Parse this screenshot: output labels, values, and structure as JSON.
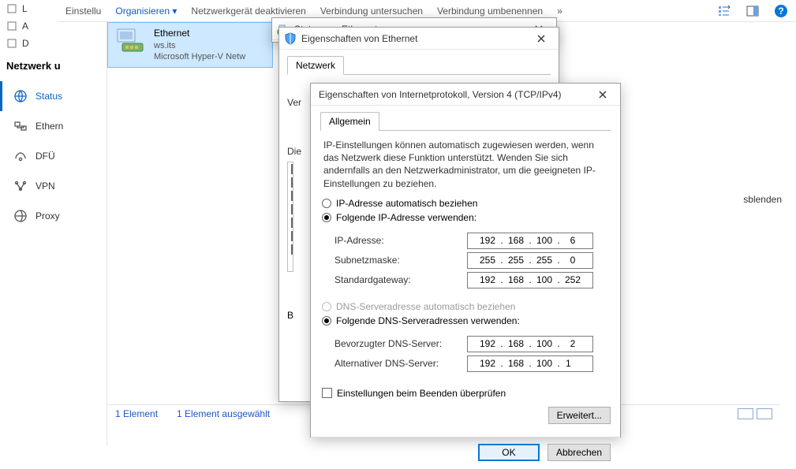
{
  "sidebar": {
    "stubs": [
      "L",
      "A",
      "D"
    ],
    "heading": "Netzwerk u",
    "items": [
      {
        "label": "Status"
      },
      {
        "label": "Ethern"
      },
      {
        "label": "DFÜ"
      },
      {
        "label": "VPN"
      },
      {
        "label": "Proxy"
      }
    ]
  },
  "toolbar": {
    "settings": "Einstellu",
    "organize": "Organisieren ▾",
    "disable": "Netzwerkgerät deaktivieren",
    "diagnose": "Verbindung untersuchen",
    "rename": "Verbindung umbenennen",
    "overflow": "»"
  },
  "connection": {
    "name": "Ethernet",
    "domain": "ws.its",
    "adapter": "Microsoft Hyper-V Netw"
  },
  "win_status_title": "Status von Ethernet",
  "win_eth": {
    "title": "Eigenschaften von Ethernet",
    "tab": "Netzwerk",
    "line1": "Ver",
    "line2": "Die",
    "line3": "B"
  },
  "win_ipv4": {
    "title": "Eigenschaften von Internetprotokoll, Version 4 (TCP/IPv4)",
    "tab": "Allgemein",
    "desc": "IP-Einstellungen können automatisch zugewiesen werden, wenn das Netzwerk diese Funktion unterstützt. Wenden Sie sich andernfalls an den Netzwerkadministrator, um die geeigneten IP-Einstellungen zu beziehen.",
    "r_auto_ip": "IP-Adresse automatisch beziehen",
    "r_use_ip": "Folgende IP-Adresse verwenden:",
    "lbl_ip": "IP-Adresse:",
    "lbl_mask": "Subnetzmaske:",
    "lbl_gw": "Standardgateway:",
    "ip": [
      "192",
      "168",
      "100",
      "6"
    ],
    "mask": [
      "255",
      "255",
      "255",
      "0"
    ],
    "gw": [
      "192",
      "168",
      "100",
      "252"
    ],
    "r_auto_dns": "DNS-Serveradresse automatisch beziehen",
    "r_use_dns": "Folgende DNS-Serveradressen verwenden:",
    "lbl_dns1": "Bevorzugter DNS-Server:",
    "lbl_dns2": "Alternativer DNS-Server:",
    "dns1": [
      "192",
      "168",
      "100",
      "2"
    ],
    "dns2": [
      "192",
      "168",
      "100",
      "1"
    ],
    "chk_validate": "Einstellungen beim Beenden überprüfen",
    "btn_adv": "Erweitert...",
    "btn_ok": "OK",
    "btn_cancel": "Abbrechen"
  },
  "statusbar": {
    "count": "1 Element",
    "selected": "1 Element ausgewählt"
  },
  "rightstrip": "sblenden"
}
